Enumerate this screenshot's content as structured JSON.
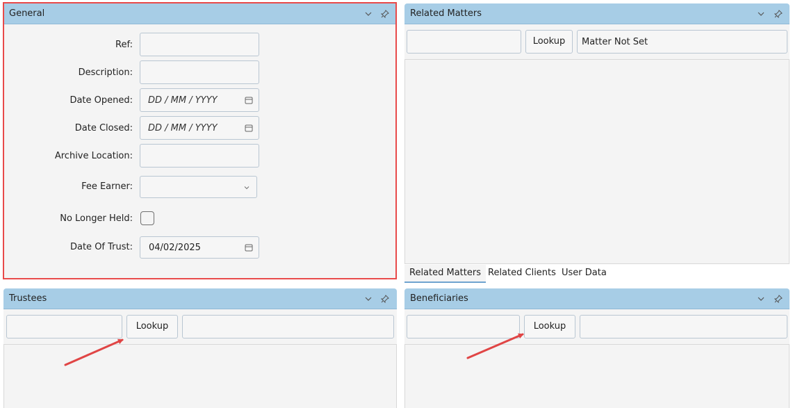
{
  "general": {
    "title": "General",
    "fields": {
      "ref_label": "Ref:",
      "description_label": "Description:",
      "date_opened_label": "Date Opened:",
      "date_opened_placeholder": "DD / MM / YYYY",
      "date_closed_label": "Date Closed:",
      "date_closed_placeholder": "DD / MM / YYYY",
      "archive_location_label": "Archive Location:",
      "fee_earner_label": "Fee Earner:",
      "no_longer_held_label": "No Longer Held:",
      "date_of_trust_label": "Date Of Trust:",
      "date_of_trust_value": "04/02/2025"
    }
  },
  "related_matters": {
    "title": "Related Matters",
    "lookup_label": "Lookup",
    "matter_status": "Matter Not Set",
    "tabs": [
      "Related Matters",
      "Related Clients",
      "User Data"
    ]
  },
  "trustees": {
    "title": "Trustees",
    "lookup_label": "Lookup"
  },
  "beneficiaries": {
    "title": "Beneficiaries",
    "lookup_label": "Lookup"
  },
  "colors": {
    "header_bg": "#a7cde6",
    "highlight_border": "#e84a4a",
    "annotation_arrow": "#e04545"
  },
  "icons": [
    "chevron-down-icon",
    "pin-icon",
    "calendar-icon"
  ]
}
